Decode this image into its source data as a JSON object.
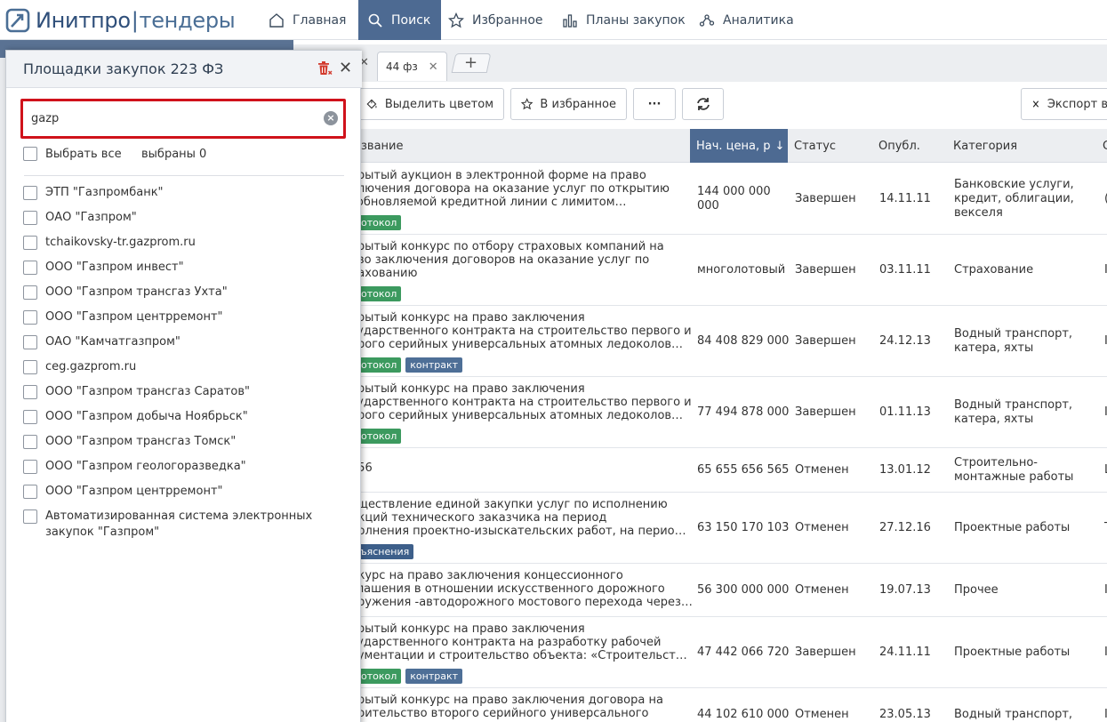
{
  "nav": {
    "logo_brand": "Инитпро",
    "logo_sep": "|",
    "logo_product": "тендеры",
    "items": [
      {
        "label": "Главная",
        "icon": "home-icon"
      },
      {
        "label": "Поиск",
        "icon": "search-icon"
      },
      {
        "label": "Избранное",
        "icon": "star-icon"
      },
      {
        "label": "Планы закупок",
        "icon": "bar-chart-icon"
      },
      {
        "label": "Аналитика",
        "icon": "analytics-icon"
      }
    ],
    "active": "Поиск"
  },
  "tabs": {
    "items": [
      {
        "label": "44 фз",
        "close": "✕"
      }
    ],
    "add": "+",
    "left_close": "✕"
  },
  "toolbar": {
    "highlight": "Выделить цветом",
    "favorite": "В избранное",
    "more": "···",
    "export": "Экспорт в"
  },
  "table": {
    "headers": {
      "name": "звание",
      "price": "Нач. цена, р",
      "price_sort": "↓",
      "status": "Статус",
      "published": "Опубл.",
      "category": "Категория",
      "edge": "С"
    },
    "rows": [
      {
        "name": "крытый аукцион в электронной форме на право\nключения договора на оказание услуг по открытию\nзобновляемой кредитной линии с лимитом…",
        "badges": [
          {
            "text": "ротокол",
            "kind": "protocol"
          }
        ],
        "price": "144 000 000\n000",
        "status": "Завершен",
        "date": "14.11.11",
        "category": "Банковские услуги,\nкредит, облигации,\nвекселя",
        "edge": "("
      },
      {
        "name": "крытый конкурс по отбору страховых компаний на\nаво заключения договоров на оказание услуг по\nрахованию",
        "badges": [
          {
            "text": "ротокол",
            "kind": "protocol"
          }
        ],
        "price": "многолотовый",
        "status": "Завершен",
        "date": "03.11.11",
        "category": "Страхование",
        "edge": "I"
      },
      {
        "name": "крытый конкурс на право заключения\nсударственного контракта на строительство первого и\nорого серийных универсальных атомных ледоколов…",
        "badges": [
          {
            "text": "ротокол",
            "kind": "protocol"
          },
          {
            "text": "контракт",
            "kind": "contract"
          }
        ],
        "price": "84 408 829 000",
        "status": "Завершен",
        "date": "24.12.13",
        "category": "Водный транспорт,\nкатера, яхты",
        "edge": "I"
      },
      {
        "name": "крытый конкурс на право заключения\nсударственного контракта на строительство первого и\nорого серийных универсальных атомных ледоколов…",
        "badges": [
          {
            "text": "ротокол",
            "kind": "protocol"
          }
        ],
        "price": "77 494 878 000",
        "status": "Завершен",
        "date": "01.11.13",
        "category": "Водный транспорт,\nкатера, яхты",
        "edge": "I"
      },
      {
        "name": "656",
        "badges": [],
        "price": "65 655 656 565",
        "status": "Отменен",
        "date": "13.01.12",
        "category": "Строительно-\nмонтажные работы",
        "edge": "L"
      },
      {
        "name": "уществление единой закупки услуг по исполнению\nнкций технического заказчика на период\nполнения проектно-изыскательских работ, на перио…",
        "badges": [
          {
            "text": "зъяснения",
            "kind": "clarify"
          }
        ],
        "price": "63 150 170 103",
        "status": "Отменен",
        "date": "27.12.16",
        "category": "Проектные работы",
        "edge": "T"
      },
      {
        "name": "нкурс на право заключения концессионного\nглашения в отношении искусственного дорожного\nоружения -автодорожного мостового перехода через…",
        "badges": [],
        "price": "56 300 000 000",
        "status": "Отменен",
        "date": "19.07.13",
        "category": "Прочее",
        "edge": "I"
      },
      {
        "name": "крытый конкурс на право заключения\nсударственного контракта на разработку рабочей\nкументации и строительство объекта: «Строительст…",
        "badges": [
          {
            "text": "ротокол",
            "kind": "protocol"
          },
          {
            "text": "контракт",
            "kind": "contract"
          }
        ],
        "price": "47 442 066 720",
        "status": "Завершен",
        "date": "24.11.11",
        "category": "Проектные работы",
        "edge": "I"
      },
      {
        "name": "крытый конкурс на право заключения договора на\nроительство второго серийного универсального",
        "badges": [],
        "price": "44 102 610 000",
        "status": "Отменен",
        "date": "23.05.13",
        "category": "Водный транспорт,",
        "edge": "I"
      }
    ]
  },
  "panel": {
    "title": "Площадки закупок 223 ФЗ",
    "search_value": "gazp",
    "clear": "×",
    "select_all": "Выбрать все",
    "selected_count": "выбраны 0",
    "options": [
      "ЭТП \"Газпромбанк\"",
      "ОАО \"Газпром\"",
      "tchaikovsky-tr.gazprom.ru",
      "ООО \"Газпром инвест\"",
      "ООО \"Газпром трансгаз Ухта\"",
      "ООО \"Газпром центрремонт\"",
      "ОАО \"Камчатгазпром\"",
      "ceg.gazprom.ru",
      "ООО \"Газпром трансгаз Саратов\"",
      "ООО \"Газпром добыча Ноябрьск\"",
      "ООО \"Газпром трансгаз Томск\"",
      "ООО \"Газпром геологоразведка\"",
      "ООО \"Газпром центрремонт\"",
      "Автоматизированная система электронных\nзакупок \"Газпром\""
    ]
  },
  "colors": {
    "accent": "#4d6a92",
    "protocol": "#3c9a5f",
    "contract": "#4e6f97",
    "highlight_border": "#d0121b",
    "trash": "#d23b2e"
  }
}
